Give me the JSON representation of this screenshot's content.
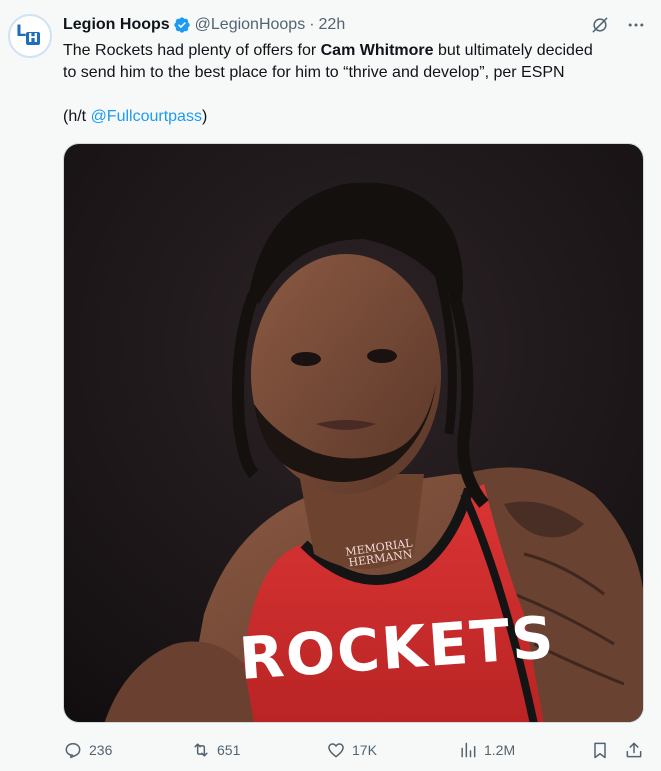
{
  "tweet": {
    "author": {
      "display_name": "Legion Hoops",
      "handle": "@LegionHoops",
      "verified": true,
      "avatar_text_top": "L",
      "avatar_text_bottom": "H"
    },
    "separator": "·",
    "time": "22h",
    "text": {
      "line1_pre": "The Rockets had plenty of offers for ",
      "line1_bold": "Cam Whitmore",
      "line1_post": " but ultimately decided",
      "line2": "to send him to the best place for him to “thrive and develop”, per ESPN",
      "line3_pre": "(h/t ",
      "line3_link": "@Fullcourtpass",
      "line3_post": ")"
    },
    "media": {
      "jersey_text": "ROCKETS",
      "sponsor_line1": "MEMORIAL",
      "sponsor_line2": "HERMANN"
    },
    "metrics": {
      "replies": "236",
      "reposts": "651",
      "likes": "17K",
      "views": "1.2M"
    },
    "colors": {
      "accent": "#1d9bf0",
      "verified": "#1d9bf0",
      "jersey": "#d22f2f",
      "muted": "#536471"
    }
  },
  "icons": {
    "verified": "verified-badge-icon",
    "grok": "slashed-circle-icon",
    "more": "more-dots-icon",
    "reply": "speech-bubble-icon",
    "repost": "repost-arrows-icon",
    "like": "heart-icon",
    "views": "bar-chart-icon",
    "bookmark": "bookmark-icon",
    "share": "share-upload-icon"
  }
}
